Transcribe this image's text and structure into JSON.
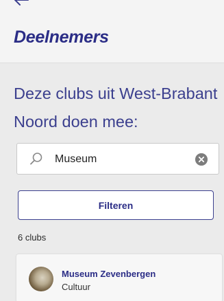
{
  "header": {
    "title": "Deelnemers",
    "back_icon": "arrow-left-icon"
  },
  "intro": {
    "text": "Deze clubs uit West-Brabant Noord doen mee:"
  },
  "search": {
    "value": "Museum",
    "search_icon": "search-icon",
    "clear_icon": "clear-icon"
  },
  "filter": {
    "label": "Filteren"
  },
  "results": {
    "count_label": "6 clubs",
    "items": [
      {
        "name": "Museum Zevenbergen",
        "category": "Cultuur"
      }
    ]
  },
  "colors": {
    "accent": "#2b2d86",
    "background": "#ebebeb",
    "header_background": "#f4f4f4"
  }
}
